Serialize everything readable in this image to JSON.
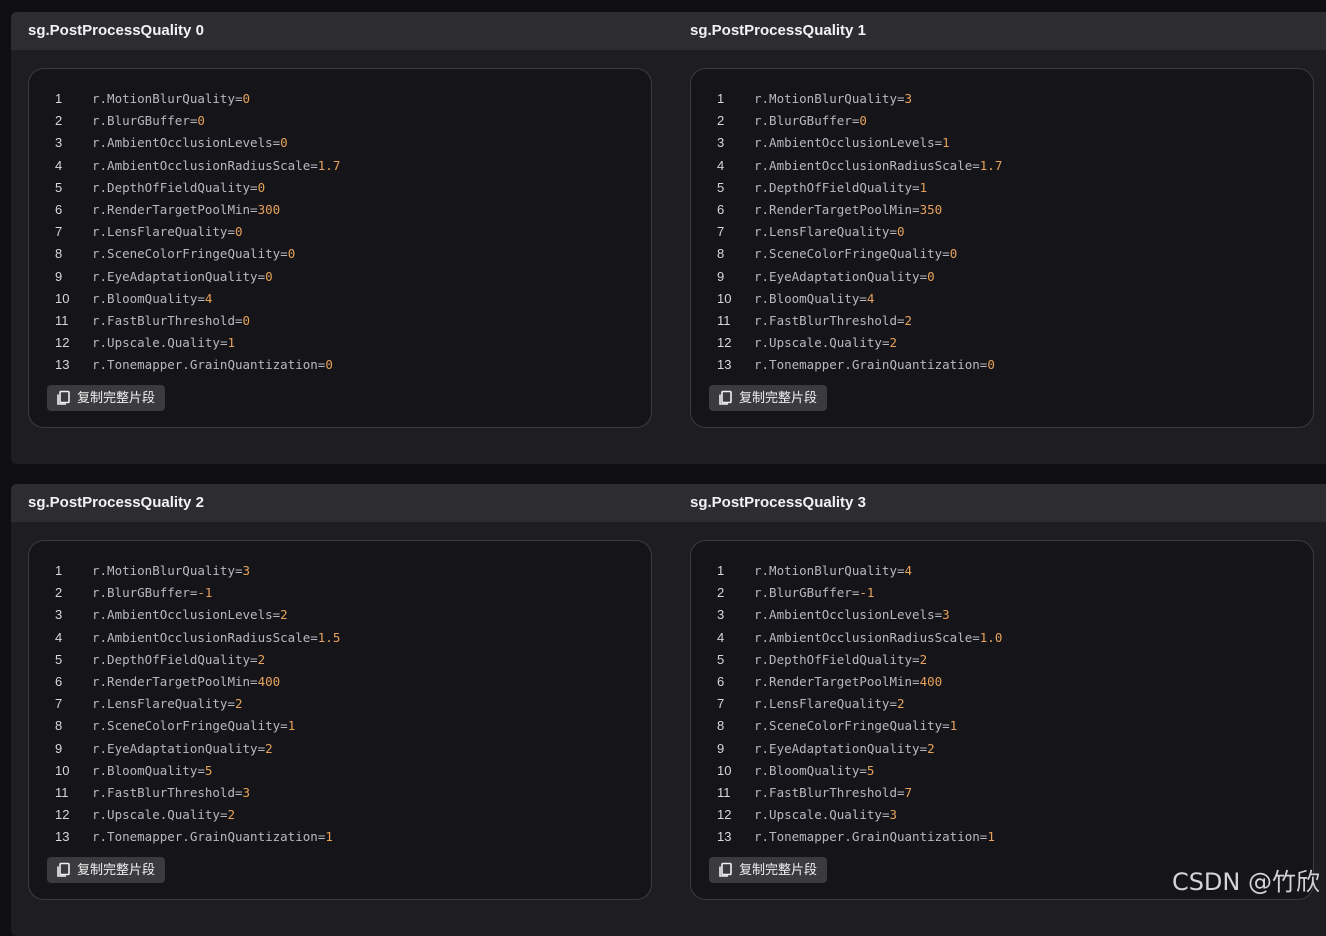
{
  "copy_label": "复制完整片段",
  "watermark": "CSDN @竹欣",
  "sections": [
    {
      "title": "sg.PostProcessQuality 0",
      "lines": [
        {
          "n": "1",
          "k": "r.MotionBlurQuality",
          "v": "0"
        },
        {
          "n": "2",
          "k": "r.BlurGBuffer",
          "v": "0"
        },
        {
          "n": "3",
          "k": "r.AmbientOcclusionLevels",
          "v": "0"
        },
        {
          "n": "4",
          "k": "r.AmbientOcclusionRadiusScale",
          "v": "1.7"
        },
        {
          "n": "5",
          "k": "r.DepthOfFieldQuality",
          "v": "0"
        },
        {
          "n": "6",
          "k": "r.RenderTargetPoolMin",
          "v": "300"
        },
        {
          "n": "7",
          "k": "r.LensFlareQuality",
          "v": "0"
        },
        {
          "n": "8",
          "k": "r.SceneColorFringeQuality",
          "v": "0"
        },
        {
          "n": "9",
          "k": "r.EyeAdaptationQuality",
          "v": "0"
        },
        {
          "n": "10",
          "k": "r.BloomQuality",
          "v": "4"
        },
        {
          "n": "11",
          "k": "r.FastBlurThreshold",
          "v": "0"
        },
        {
          "n": "12",
          "k": "r.Upscale.Quality",
          "v": "1"
        },
        {
          "n": "13",
          "k": "r.Tonemapper.GrainQuantization",
          "v": "0"
        }
      ]
    },
    {
      "title": "sg.PostProcessQuality 1",
      "lines": [
        {
          "n": "1",
          "k": "r.MotionBlurQuality",
          "v": "3"
        },
        {
          "n": "2",
          "k": "r.BlurGBuffer",
          "v": "0"
        },
        {
          "n": "3",
          "k": "r.AmbientOcclusionLevels",
          "v": "1"
        },
        {
          "n": "4",
          "k": "r.AmbientOcclusionRadiusScale",
          "v": "1.7"
        },
        {
          "n": "5",
          "k": "r.DepthOfFieldQuality",
          "v": "1"
        },
        {
          "n": "6",
          "k": "r.RenderTargetPoolMin",
          "v": "350"
        },
        {
          "n": "7",
          "k": "r.LensFlareQuality",
          "v": "0"
        },
        {
          "n": "8",
          "k": "r.SceneColorFringeQuality",
          "v": "0"
        },
        {
          "n": "9",
          "k": "r.EyeAdaptationQuality",
          "v": "0"
        },
        {
          "n": "10",
          "k": "r.BloomQuality",
          "v": "4"
        },
        {
          "n": "11",
          "k": "r.FastBlurThreshold",
          "v": "2"
        },
        {
          "n": "12",
          "k": "r.Upscale.Quality",
          "v": "2"
        },
        {
          "n": "13",
          "k": "r.Tonemapper.GrainQuantization",
          "v": "0"
        }
      ]
    },
    {
      "title": "sg.PostProcessQuality 2",
      "lines": [
        {
          "n": "1",
          "k": "r.MotionBlurQuality",
          "v": "3"
        },
        {
          "n": "2",
          "k": "r.BlurGBuffer",
          "v": "-1"
        },
        {
          "n": "3",
          "k": "r.AmbientOcclusionLevels",
          "v": "2"
        },
        {
          "n": "4",
          "k": "r.AmbientOcclusionRadiusScale",
          "v": "1.5"
        },
        {
          "n": "5",
          "k": "r.DepthOfFieldQuality",
          "v": "2"
        },
        {
          "n": "6",
          "k": "r.RenderTargetPoolMin",
          "v": "400"
        },
        {
          "n": "7",
          "k": "r.LensFlareQuality",
          "v": "2"
        },
        {
          "n": "8",
          "k": "r.SceneColorFringeQuality",
          "v": "1"
        },
        {
          "n": "9",
          "k": "r.EyeAdaptationQuality",
          "v": "2"
        },
        {
          "n": "10",
          "k": "r.BloomQuality",
          "v": "5"
        },
        {
          "n": "11",
          "k": "r.FastBlurThreshold",
          "v": "3"
        },
        {
          "n": "12",
          "k": "r.Upscale.Quality",
          "v": "2"
        },
        {
          "n": "13",
          "k": "r.Tonemapper.GrainQuantization",
          "v": "1"
        }
      ]
    },
    {
      "title": "sg.PostProcessQuality 3",
      "lines": [
        {
          "n": "1",
          "k": "r.MotionBlurQuality",
          "v": "4"
        },
        {
          "n": "2",
          "k": "r.BlurGBuffer",
          "v": "-1"
        },
        {
          "n": "3",
          "k": "r.AmbientOcclusionLevels",
          "v": "3"
        },
        {
          "n": "4",
          "k": "r.AmbientOcclusionRadiusScale",
          "v": "1.0"
        },
        {
          "n": "5",
          "k": "r.DepthOfFieldQuality",
          "v": "2"
        },
        {
          "n": "6",
          "k": "r.RenderTargetPoolMin",
          "v": "400"
        },
        {
          "n": "7",
          "k": "r.LensFlareQuality",
          "v": "2"
        },
        {
          "n": "8",
          "k": "r.SceneColorFringeQuality",
          "v": "1"
        },
        {
          "n": "9",
          "k": "r.EyeAdaptationQuality",
          "v": "2"
        },
        {
          "n": "10",
          "k": "r.BloomQuality",
          "v": "5"
        },
        {
          "n": "11",
          "k": "r.FastBlurThreshold",
          "v": "7"
        },
        {
          "n": "12",
          "k": "r.Upscale.Quality",
          "v": "3"
        },
        {
          "n": "13",
          "k": "r.Tonemapper.GrainQuantization",
          "v": "1"
        }
      ]
    }
  ]
}
